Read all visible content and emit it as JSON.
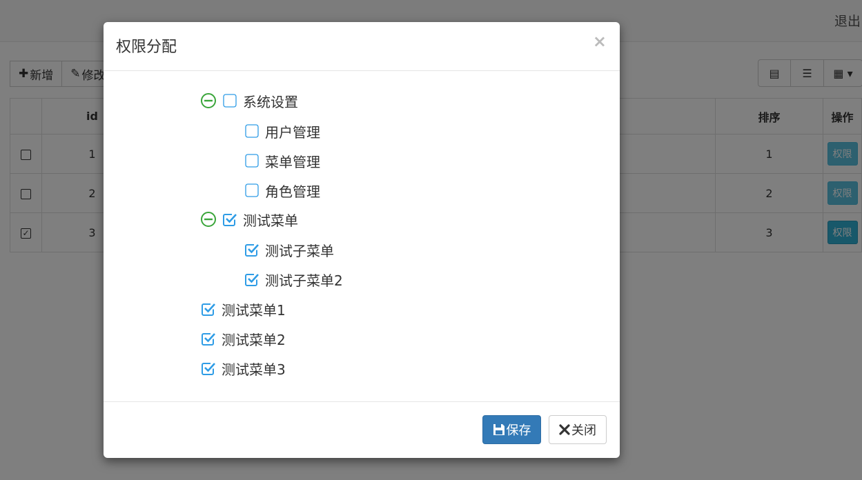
{
  "header": {
    "logout": "退出"
  },
  "toolbar": {
    "add_label": "新增",
    "edit_label": "修改"
  },
  "table": {
    "columns": [
      "id",
      "排序",
      "操作"
    ],
    "rows": [
      {
        "id": "1",
        "sort": "1",
        "action": "权限",
        "checked": false
      },
      {
        "id": "2",
        "sort": "2",
        "action": "权限",
        "checked": false
      },
      {
        "id": "3",
        "sort": "3",
        "action": "权限",
        "checked": true
      }
    ]
  },
  "modal": {
    "title": "权限分配",
    "close_symbol": "×",
    "tree": [
      {
        "label": "系统设置",
        "checked": false,
        "expanded": true,
        "level": 0,
        "children": [
          {
            "label": "用户管理",
            "checked": false
          },
          {
            "label": "菜单管理",
            "checked": false
          },
          {
            "label": "角色管理",
            "checked": false
          }
        ]
      },
      {
        "label": "测试菜单",
        "checked": true,
        "expanded": true,
        "level": 0,
        "children": [
          {
            "label": "测试子菜单",
            "checked": true
          },
          {
            "label": "测试子菜单2",
            "checked": true
          }
        ]
      },
      {
        "label": "测试菜单1",
        "checked": true
      },
      {
        "label": "测试菜单2",
        "checked": true
      },
      {
        "label": "测试菜单3",
        "checked": true
      }
    ],
    "save_label": "保存",
    "close_label": "关闭"
  },
  "colors": {
    "primary": "#337ab7",
    "check": "#2e9ce6",
    "toggle": "#3aa53a",
    "info": "#5bc0de"
  }
}
